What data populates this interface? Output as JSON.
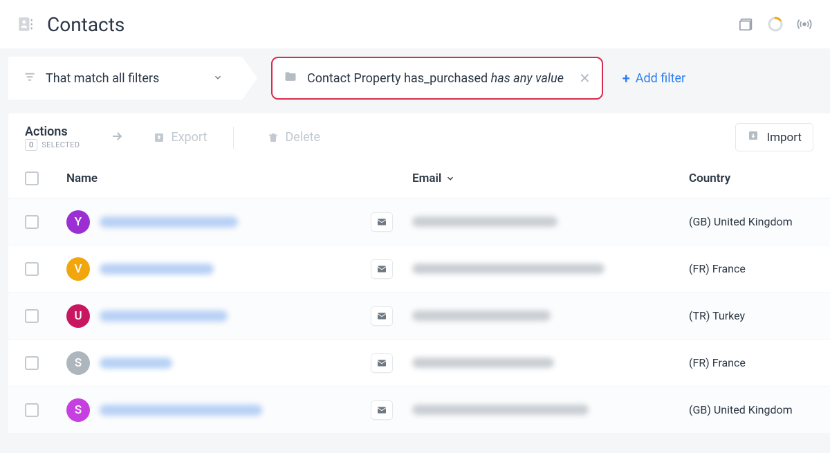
{
  "header": {
    "title": "Contacts"
  },
  "filter": {
    "match_label": "That match all filters",
    "chip": {
      "prefix": "Contact Property has_purchased ",
      "italic": "has any value"
    },
    "add_filter": "Add filter"
  },
  "toolbar": {
    "actions": "Actions",
    "selected_count": "0",
    "selected_label": "SELECTED",
    "export": "Export",
    "delete": "Delete",
    "import": "Import"
  },
  "table": {
    "headers": {
      "name": "Name",
      "email": "Email",
      "country": "Country"
    },
    "rows": [
      {
        "initial": "Y",
        "avatar_color": "#9b2fd4",
        "name_w": 200,
        "email_w": 210,
        "country": "(GB) United Kingdom"
      },
      {
        "initial": "V",
        "avatar_color": "#f2a60d",
        "name_w": 165,
        "email_w": 278,
        "country": "(FR) France"
      },
      {
        "initial": "U",
        "avatar_color": "#c91661",
        "name_w": 185,
        "email_w": 200,
        "country": "(TR) Turkey"
      },
      {
        "initial": "S",
        "avatar_color": "#aeb6bd",
        "name_w": 105,
        "email_w": 205,
        "country": "(FR) France"
      },
      {
        "initial": "S",
        "avatar_color": "#c63fe0",
        "name_w": 235,
        "email_w": 255,
        "country": "(GB) United Kingdom"
      }
    ]
  }
}
